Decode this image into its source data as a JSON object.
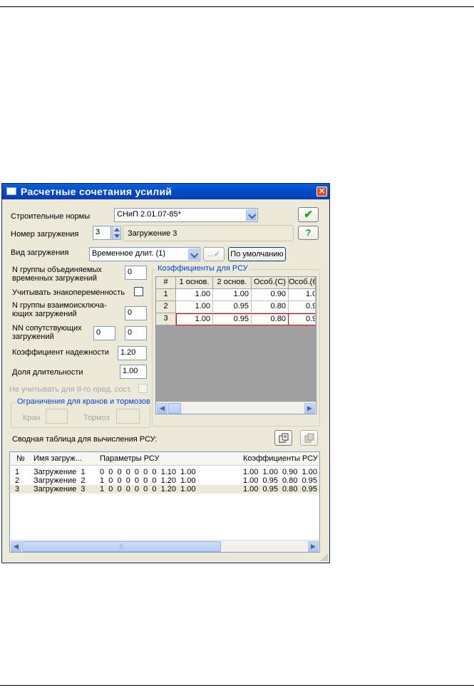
{
  "window": {
    "title": "Расчетные сочетания усилий",
    "close_glyph": "✕"
  },
  "form": {
    "norms_label": "Строительные нормы",
    "norms_value": "СНиП 2.01.07-85*",
    "ok_glyph": "✔",
    "help_glyph": "?",
    "load_number_label": "Номер загружения",
    "load_number_value": "3",
    "load_name_value": "Загружение  3",
    "load_type_label": "Вид загружения",
    "load_type_value": "Временное длит.   (1)",
    "apply_glyph": "...✓",
    "default_button": "По умолчанию",
    "combined_group_label": "N группы объединяемых временных загружений",
    "combined_group_value": "0",
    "alternating_label": "Учитывать знакопеременность",
    "exclusive_group_label": "N группы взаимоисключа-ющих загружений",
    "exclusive_group_value": "0",
    "accompanying_label": "NN сопутствующих загружений",
    "accompanying_value1": "0",
    "accompanying_value2": "0",
    "reliability_label": "Коэффициент надежности",
    "reliability_value": "1.20",
    "duration_label": "Доля длительности",
    "duration_value": "1.00",
    "ignore_label": "Не учитывать для II-го пред. сост.",
    "limits_group_title": "Ограничения для кранов и тормозов",
    "crane_label": "Кран",
    "brake_label": "Тормоз"
  },
  "coef_grid": {
    "group_title": "Коэффициенты для РСУ",
    "headers": [
      "#",
      "1 основ.",
      "2 основ.",
      "Особ.(С)",
      "Особ.(6"
    ],
    "rows": [
      [
        "1",
        "1.00",
        "1.00",
        "0.90",
        "1.0"
      ],
      [
        "2",
        "1.00",
        "0.95",
        "0.80",
        "0.9"
      ],
      [
        "3",
        "1.00",
        "0.95",
        "0.80",
        "0.9"
      ]
    ]
  },
  "summary": {
    "label": "Сводная таблица для вычисления РСУ:",
    "headers": [
      "№",
      "Имя загруж...",
      "Параметры РСУ",
      "Коэффициенты РСУ"
    ],
    "rows": [
      [
        "1",
        "Загружение  1",
        "0  0  0  0  0  0  0  1.10  1.00",
        "1.00  1.00  0.90  1.00"
      ],
      [
        "2",
        "Загружение  2",
        "1  0  0  0  0  0  0  1.20  1.00",
        "1.00  0.95  0.80  0.95"
      ],
      [
        "3",
        "Загружение  3",
        "1  0  0  0  0  0  0  1.20  1.00",
        "1.00  0.95  0.80  0.95"
      ]
    ]
  },
  "icons": {
    "grid_scroll_left": "◀",
    "grid_scroll_right": "▶",
    "list_scroll_left": "◀",
    "list_scroll_right": "▶",
    "list_thumb_grip": "|||"
  },
  "colors": {
    "titlebar": "#0a5fd8",
    "accent_ok": "#1aa01a",
    "group_title": "#0046d5",
    "selection_border": "#e00000"
  }
}
